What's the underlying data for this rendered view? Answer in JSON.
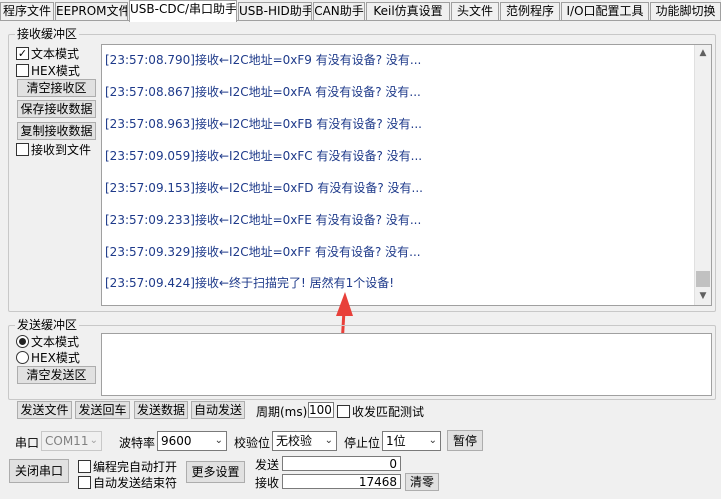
{
  "tabs": [
    {
      "label": "程序文件"
    },
    {
      "label": "EEPROM文件"
    },
    {
      "label": "USB-CDC/串口助手"
    },
    {
      "label": "USB-HID助手"
    },
    {
      "label": "CAN助手"
    },
    {
      "label": "Keil仿真设置"
    },
    {
      "label": "头文件"
    },
    {
      "label": "范例程序"
    },
    {
      "label": "I/O口配置工具"
    },
    {
      "label": "功能脚切换"
    }
  ],
  "receive": {
    "title": "接收缓冲区",
    "text_mode": "文本模式",
    "hex_mode": "HEX模式",
    "clear_btn": "清空接收区",
    "save_btn": "保存接收数据",
    "copy_btn": "复制接收数据",
    "to_file": "接收到文件",
    "lines": [
      "[23:57:08.790]接收←I2C地址=0xF9 有没有设备? 没有...",
      "[23:57:08.867]接收←I2C地址=0xFA 有没有设备? 没有...",
      "[23:57:08.963]接收←I2C地址=0xFB 有没有设备? 没有...",
      "[23:57:09.059]接收←I2C地址=0xFC 有没有设备? 没有...",
      "[23:57:09.153]接收←I2C地址=0xFD 有没有设备? 没有...",
      "[23:57:09.233]接收←I2C地址=0xFE 有没有设备? 没有...",
      "[23:57:09.329]接收←I2C地址=0xFF 有没有设备? 没有...",
      "[23:57:09.424]接收←终于扫描完了! 居然有1个设备!"
    ]
  },
  "send": {
    "title": "发送缓冲区",
    "text_mode": "文本模式",
    "hex_mode": "HEX模式",
    "clear_btn": "清空发送区"
  },
  "actions": {
    "send_file": "发送文件",
    "send_enter": "发送回车",
    "send_data": "发送数据",
    "auto_send": "自动发送",
    "period_label": "周期(ms)",
    "period_value": "100",
    "match_test": "收发匹配测试"
  },
  "serial": {
    "port_label": "串口",
    "port_value": "COM11",
    "baud_label": "波特率",
    "baud_value": "9600",
    "parity_label": "校验位",
    "parity_value": "无校验",
    "stop_label": "停止位",
    "stop_value": "1位",
    "pause_btn": "暂停",
    "close_btn": "关闭串口",
    "auto_open": "编程完自动打开",
    "auto_end": "自动发送结束符",
    "more_btn": "更多设置",
    "sent_label": "发送",
    "sent_value": "0",
    "recv_label": "接收",
    "recv_value": "17468",
    "clear_count_btn": "清零"
  },
  "colors": {
    "log_text": "#1e3a8a",
    "arrow": "#e8403a"
  },
  "icons": {
    "checked": "✓",
    "scroll_up": "▲",
    "scroll_down": "▼",
    "dropdown": "⌄"
  }
}
